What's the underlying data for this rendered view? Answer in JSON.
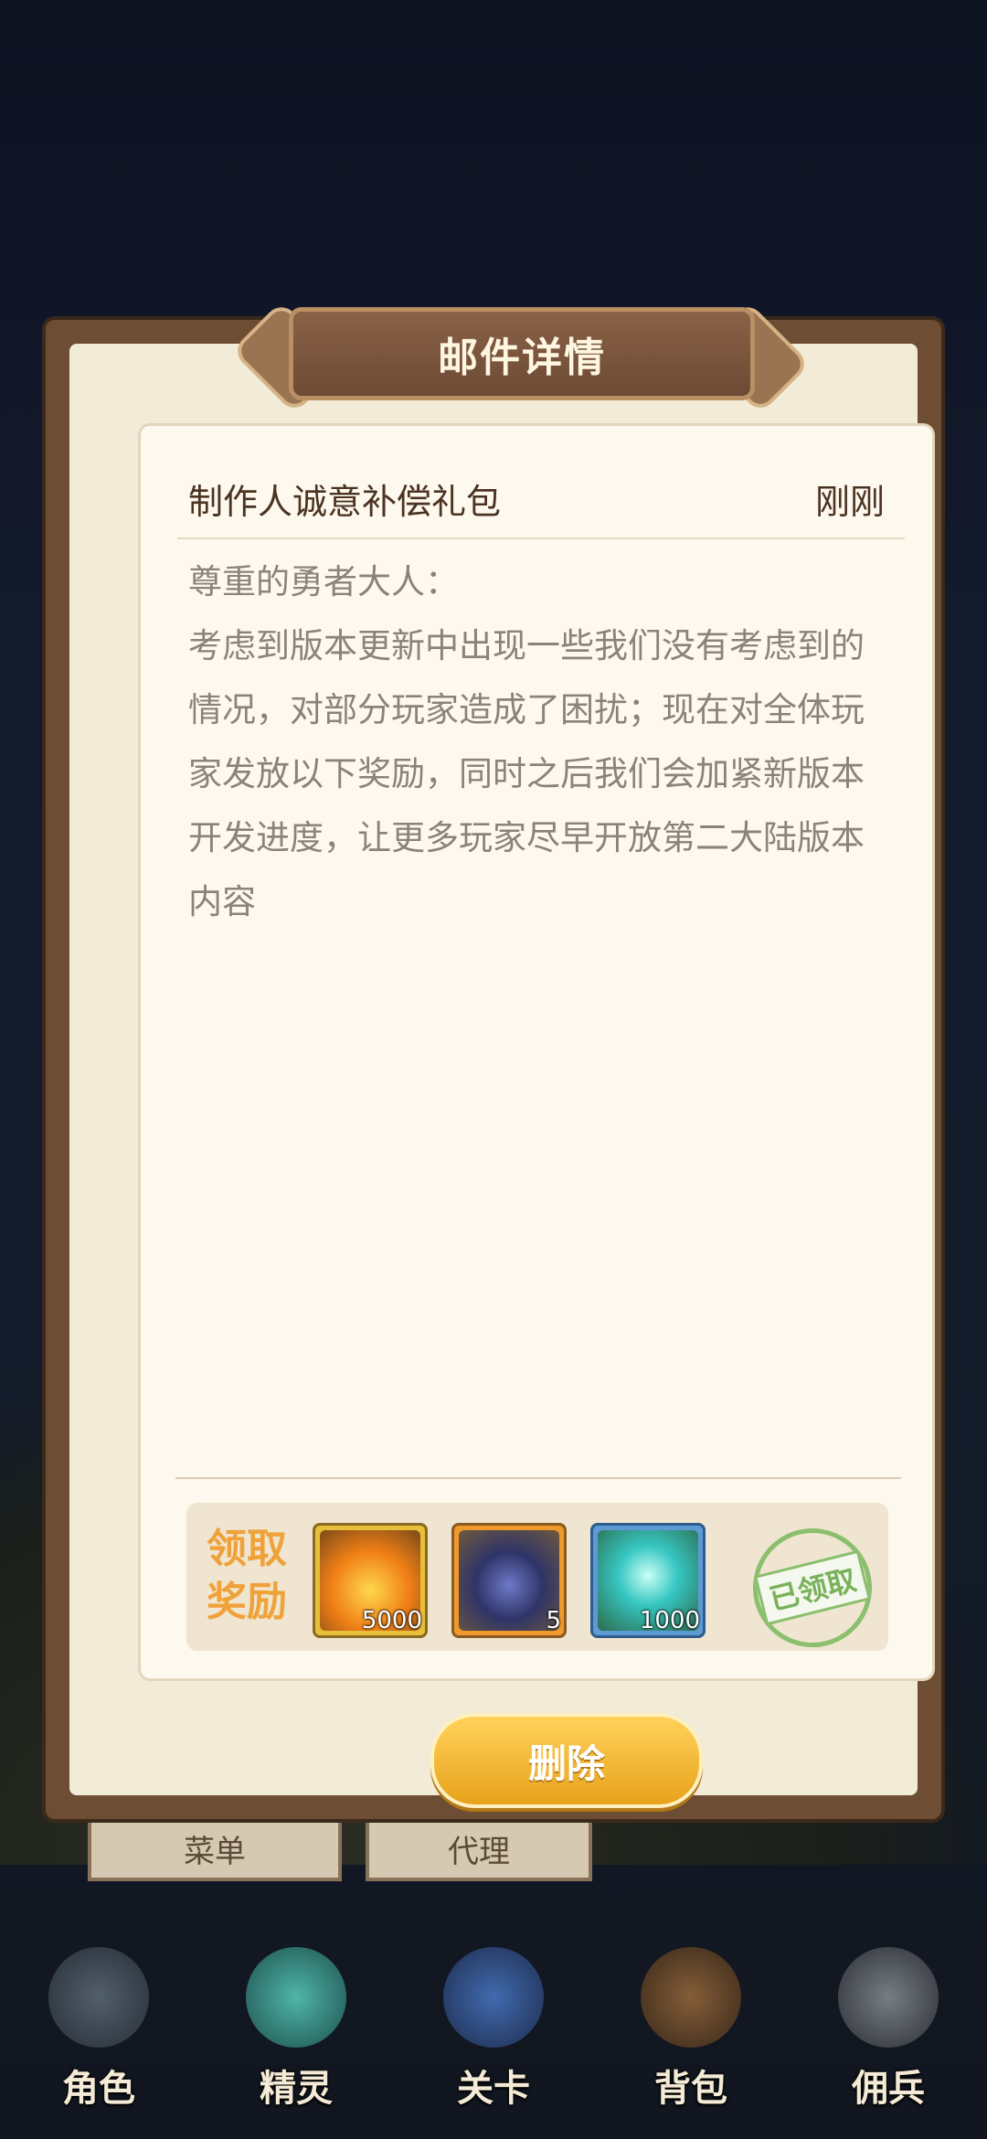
{
  "dialog": {
    "title": "邮件详情",
    "mail": {
      "subject": "制作人诚意补偿礼包",
      "time": "刚刚",
      "body": "尊重的勇者大人：\n考虑到版本更新中出现一些我们没有考虑到的情况，对部分玩家造成了困扰；现在对全体玩家发放以下奖励，同时之后我们会加紧新版本开发进度，让更多玩家尽早开放第二大陆版本内容"
    },
    "rewards": {
      "label": "领取\n奖励",
      "items": [
        {
          "icon": "fire-crystal-icon",
          "qty": "5000"
        },
        {
          "icon": "dark-stone-icon",
          "qty": "5"
        },
        {
          "icon": "spirit-herb-icon",
          "qty": "1000"
        }
      ],
      "stamp": "已领取"
    },
    "delete_label": "删除"
  },
  "background_tabs": [
    "菜单",
    "代理"
  ],
  "bottom_nav": [
    {
      "label": "角色",
      "icon": "hero-icon"
    },
    {
      "label": "精灵",
      "icon": "spirit-icon"
    },
    {
      "label": "关卡",
      "icon": "stage-icon"
    },
    {
      "label": "背包",
      "icon": "backpack-icon"
    },
    {
      "label": "佣兵",
      "icon": "mercenary-icon"
    }
  ]
}
